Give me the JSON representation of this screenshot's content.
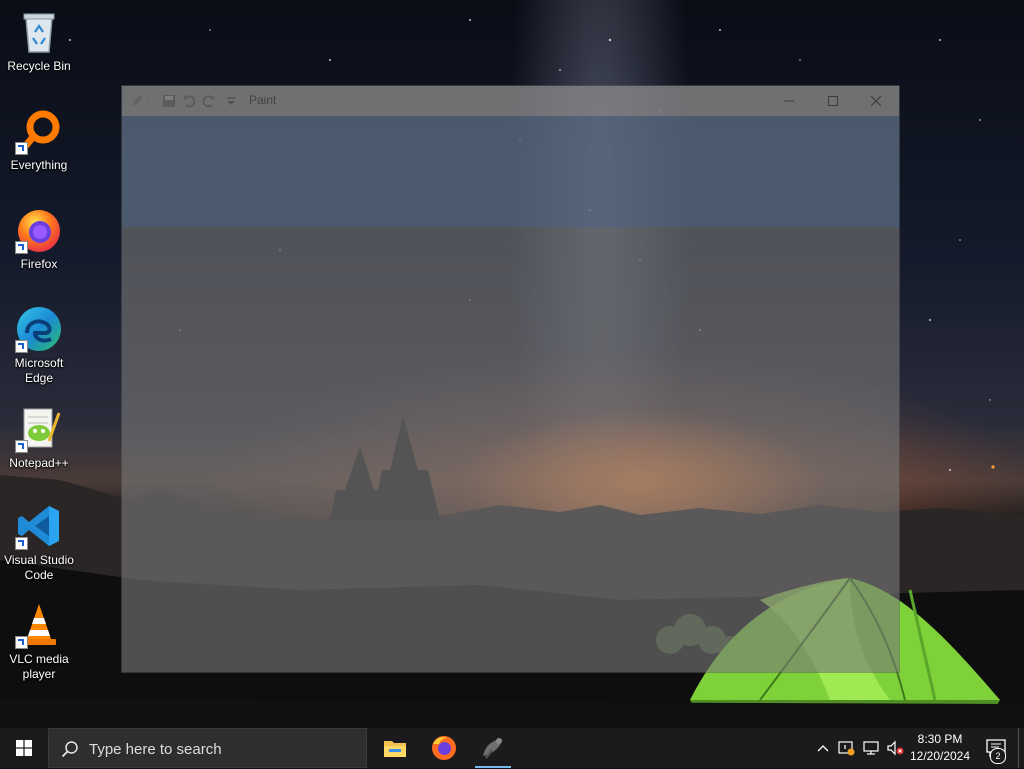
{
  "desktop": {
    "icons": [
      {
        "label": "Recycle Bin"
      },
      {
        "label": "Everything"
      },
      {
        "label": "Firefox"
      },
      {
        "label": "Microsoft Edge"
      },
      {
        "label": "Notepad++"
      },
      {
        "label": "Visual Studio Code"
      },
      {
        "label": "VLC media player"
      }
    ]
  },
  "paint_window": {
    "title": "Paint",
    "quick_access": [
      "paint-app-icon",
      "save-icon",
      "undo-icon",
      "redo-icon",
      "customize-dropdown-icon"
    ],
    "controls": [
      "minimize-icon",
      "maximize-icon",
      "close-icon"
    ]
  },
  "taskbar": {
    "search_placeholder": "Type here to search",
    "pinned_apps": [
      "file-explorer-icon",
      "firefox-icon",
      "paint-icon"
    ],
    "tray_icons": [
      "chevron-up-icon",
      "security-alert-icon",
      "network-icon",
      "volume-muted-icon"
    ],
    "clock": {
      "time": "8:30 PM",
      "date": "12/20/2024"
    },
    "notification_count": "2"
  },
  "colors": {
    "taskbar_bg": "#1b1b1d",
    "search_bg": "#2e2e30",
    "active_indicator": "#76b9ed",
    "windows_blue": "#1d8fe1"
  }
}
